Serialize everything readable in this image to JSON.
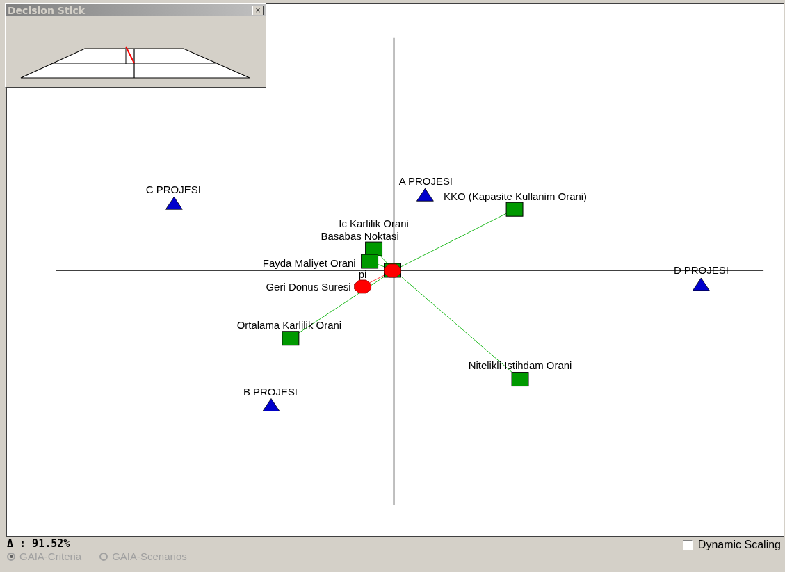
{
  "decision_stick": {
    "title": "Decision Stick",
    "close": "×"
  },
  "plot": {
    "scenarios": [
      {
        "label": "A PROJESI"
      },
      {
        "label": "C PROJESI"
      },
      {
        "label": "D PROJESI"
      },
      {
        "label": "B PROJESI"
      }
    ],
    "criteria": [
      {
        "label": "KKO (Kapasite Kullanim Orani)"
      },
      {
        "label": "Ic Karlilik Orani"
      },
      {
        "label": "Basabas Noktasi"
      },
      {
        "label": "Fayda Maliyet Orani"
      },
      {
        "label": "Geri Donus Suresi"
      },
      {
        "label": "Ortalama Karlilik Orani"
      },
      {
        "label": "Nitelikli Istihdam  Orani"
      }
    ],
    "pi": {
      "label": "pi"
    }
  },
  "delta": "Δ : 91.52%",
  "views": [
    {
      "label": "GAIA-Criteria",
      "selected": true,
      "disabled": true
    },
    {
      "label": "GAIA-Scenarios",
      "selected": false,
      "disabled": true
    }
  ],
  "dynamic_scaling": {
    "label": "Dynamic Scaling",
    "checked": false
  }
}
